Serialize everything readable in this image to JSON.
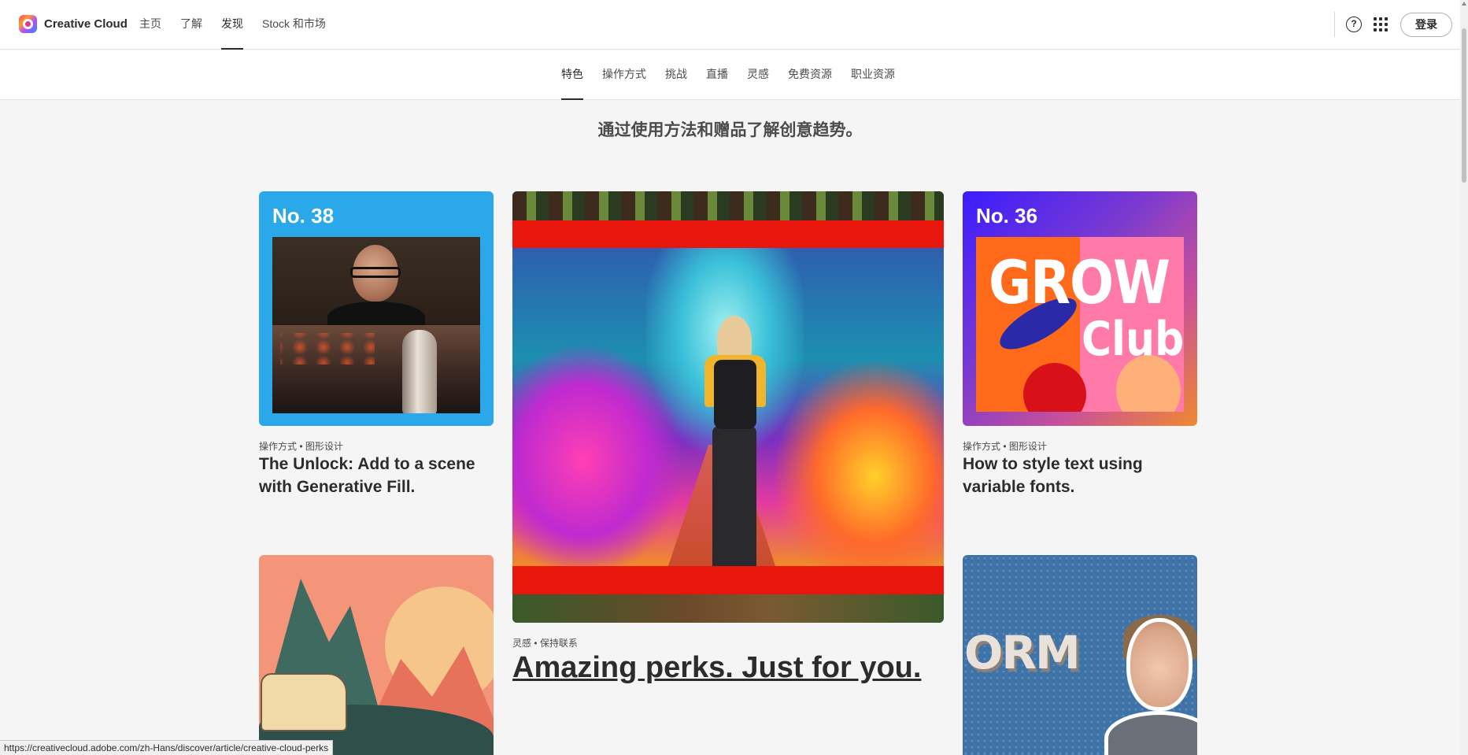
{
  "topnav": {
    "brand": "Creative Cloud",
    "links": [
      {
        "label": "主页",
        "active": false
      },
      {
        "label": "了解",
        "active": false
      },
      {
        "label": "发现",
        "active": true
      },
      {
        "label": "Stock 和市场",
        "active": false
      }
    ],
    "signin_label": "登录",
    "help_glyph": "?"
  },
  "subnav": {
    "links": [
      {
        "label": "特色",
        "active": true
      },
      {
        "label": "操作方式",
        "active": false
      },
      {
        "label": "挑战",
        "active": false
      },
      {
        "label": "直播",
        "active": false
      },
      {
        "label": "灵感",
        "active": false
      },
      {
        "label": "免费资源",
        "active": false
      },
      {
        "label": "职业资源",
        "active": false
      }
    ]
  },
  "tagline": "通过使用方法和赠品了解创意趋势。",
  "cards": [
    {
      "issue": "No. 38",
      "meta": "操作方式 • 图形设计",
      "title": "The Unlock: Add to a scene with Generative Fill."
    },
    {
      "meta": "灵感 • 保持联系",
      "title": "Amazing perks. Just for you."
    },
    {
      "issue": "No. 36",
      "art_words": [
        "GROW",
        "Club"
      ],
      "meta": "操作方式 • 图形设计",
      "title": "How to style text using variable fonts."
    },
    {
      "art_words": [
        "ORM"
      ]
    }
  ],
  "statusbar": {
    "url": "https://creativecloud.adobe.com/zh-Hans/discover/article/creative-cloud-perks"
  },
  "colors": {
    "card1_bg": "#2aa8ea",
    "hero_band": "#e8160c",
    "card3_gradient_start": "#3b1cff",
    "card3_gradient_end": "#f08a30"
  }
}
